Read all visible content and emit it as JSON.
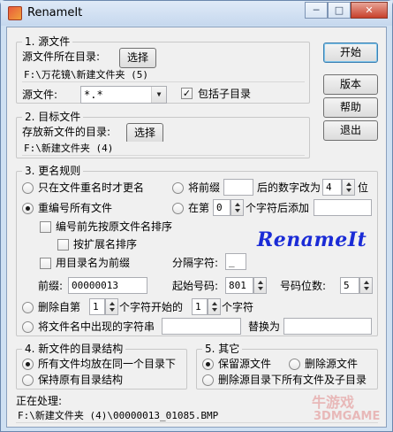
{
  "window": {
    "title": "RenameIt",
    "min_label": "─",
    "max_label": "□",
    "close_label": "✕"
  },
  "source": {
    "legend": "1. 源文件",
    "dir_label": "源文件所在目录:",
    "choose_label": "选择",
    "dir_path": "F:\\万花镜\\新建文件夹 (5)",
    "file_label": "源文件:",
    "file_pattern": "*.*",
    "include_sub_label": "包括子目录",
    "include_sub_checked": true
  },
  "target": {
    "legend": "2. 目标文件",
    "dir_label": "存放新文件的目录:",
    "choose_label": "选择",
    "dir_path": "F:\\新建文件夹 (4)"
  },
  "actions": {
    "start": "开始",
    "version": "版本",
    "help": "帮助",
    "exit": "退出"
  },
  "rules": {
    "legend": "3. 更名规则",
    "only_on_dup_label": "只在文件重名时才更名",
    "renumber_all_label": "重编号所有文件",
    "sort_by_name_label": "编号前先按原文件名排序",
    "sort_by_ext_label": "按扩展名排序",
    "use_dir_name_label": "用目录名为前缀",
    "prefix_num_label_a": "将前缀",
    "prefix_num_value": "",
    "prefix_num_label_b": "后的数字改为",
    "digits_value": "4",
    "digits_unit": "位",
    "insert_at_label_a": "在第",
    "insert_at_value": "0",
    "insert_at_label_b": "个字符后添加",
    "insert_text": "",
    "separator_label": "分隔字符:",
    "separator_value": "_",
    "prefix_label": "前缀:",
    "prefix_value": "00000013",
    "start_num_label": "起始号码:",
    "start_num_value": "801",
    "num_digits_label": "号码位数:",
    "num_digits_value": "5",
    "delete_from_label": "删除自第",
    "delete_from_value": "1",
    "delete_mid_label": "个字符开始的",
    "delete_count_value": "1",
    "delete_unit": "个字符",
    "replace_label": "将文件名中出现的字符串",
    "replace_from": "",
    "replace_with_label": "替换为",
    "replace_to": "",
    "logo_text": "RenameIt"
  },
  "new_dir": {
    "legend": "4. 新文件的目录结构",
    "same_dir_label": "所有文件均放在同一个目录下",
    "keep_structure_label": "保持原有目录结构"
  },
  "other": {
    "legend": "5. 其它",
    "keep_source_label": "保留源文件",
    "delete_source_label": "删除源文件",
    "delete_all_label": "删除源目录下所有文件及子目录"
  },
  "status": {
    "label": "正在处理:",
    "current_file": "F:\\新建文件夹 (4)\\00000013_01085.BMP"
  },
  "watermark": {
    "line1": "牛游戏",
    "line2": "3DMGAME"
  }
}
